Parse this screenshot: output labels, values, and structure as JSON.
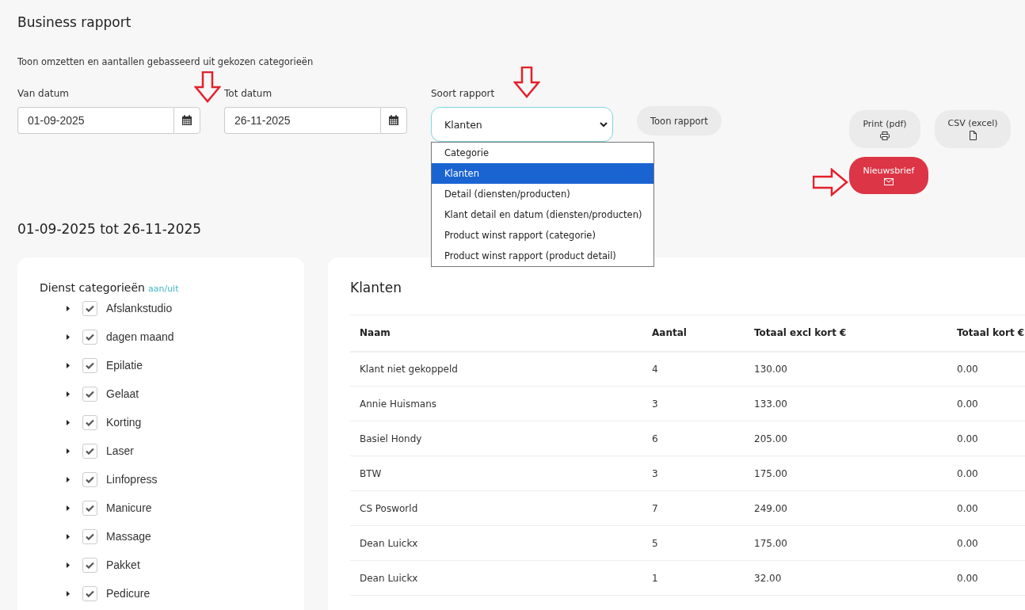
{
  "title": "Business rapport",
  "subtitle": "Toon omzetten en aantallen gebasseerd uit gekozen categorieën",
  "date_from": {
    "label": "Van datum",
    "value": "01-09-2025"
  },
  "date_to": {
    "label": "Tot datum",
    "value": "26-11-2025"
  },
  "report_type": {
    "label": "Soort rapport",
    "value": "Klanten",
    "expanded": true,
    "options": [
      {
        "label": "Categorie",
        "selected": false
      },
      {
        "label": "Klanten",
        "selected": true
      },
      {
        "label": "Detail (diensten/producten)",
        "selected": false
      },
      {
        "label": "Klant detail en datum (diensten/producten)",
        "selected": false
      },
      {
        "label": "Product winst rapport (categorie)",
        "selected": false
      },
      {
        "label": "Product winst rapport (product detail)",
        "selected": false
      }
    ]
  },
  "show_button": "Toon rapport",
  "export_buttons": [
    {
      "label": "Print (pdf)",
      "kind": "print"
    },
    {
      "label": "CSV (excel)",
      "kind": "file"
    },
    {
      "label": "Nieuwsbrief",
      "kind": "mail"
    }
  ],
  "period": "01-09-2025 tot 26-11-2025",
  "categories": {
    "title": "Dienst categorieën",
    "toggle": "aan/uit",
    "items": [
      {
        "label": "Afslankstudio",
        "checked": true,
        "expanded": false
      },
      {
        "label": "dagen maand",
        "checked": true,
        "expanded": false
      },
      {
        "label": "Epilatie",
        "checked": true,
        "expanded": false
      },
      {
        "label": "Gelaat",
        "checked": true,
        "expanded": false
      },
      {
        "label": "Korting",
        "checked": true,
        "expanded": false
      },
      {
        "label": "Laser",
        "checked": true,
        "expanded": false
      },
      {
        "label": "Linfopress",
        "checked": true,
        "expanded": false
      },
      {
        "label": "Manicure",
        "checked": true,
        "expanded": false
      },
      {
        "label": "Massage",
        "checked": true,
        "expanded": false
      },
      {
        "label": "Pakket",
        "checked": true,
        "expanded": false
      },
      {
        "label": "Pedicure",
        "checked": true,
        "expanded": false
      }
    ]
  },
  "table": {
    "title": "Klanten",
    "columns": [
      "Naam",
      "Aantal",
      "Totaal excl kort €",
      "Totaal kort €"
    ],
    "rows": [
      [
        "Klant niet gekoppeld",
        "4",
        "130.00",
        "0.00"
      ],
      [
        "Annie Huismans",
        "3",
        "133.00",
        "0.00"
      ],
      [
        "Basiel Hondy",
        "6",
        "205.00",
        "0.00"
      ],
      [
        "BTW",
        "3",
        "175.00",
        "0.00"
      ],
      [
        "CS Posworld",
        "7",
        "249.00",
        "0.00"
      ],
      [
        "Dean Luickx",
        "5",
        "175.00",
        "0.00"
      ],
      [
        "Dean Luickx",
        "1",
        "32.00",
        "0.00"
      ]
    ]
  }
}
